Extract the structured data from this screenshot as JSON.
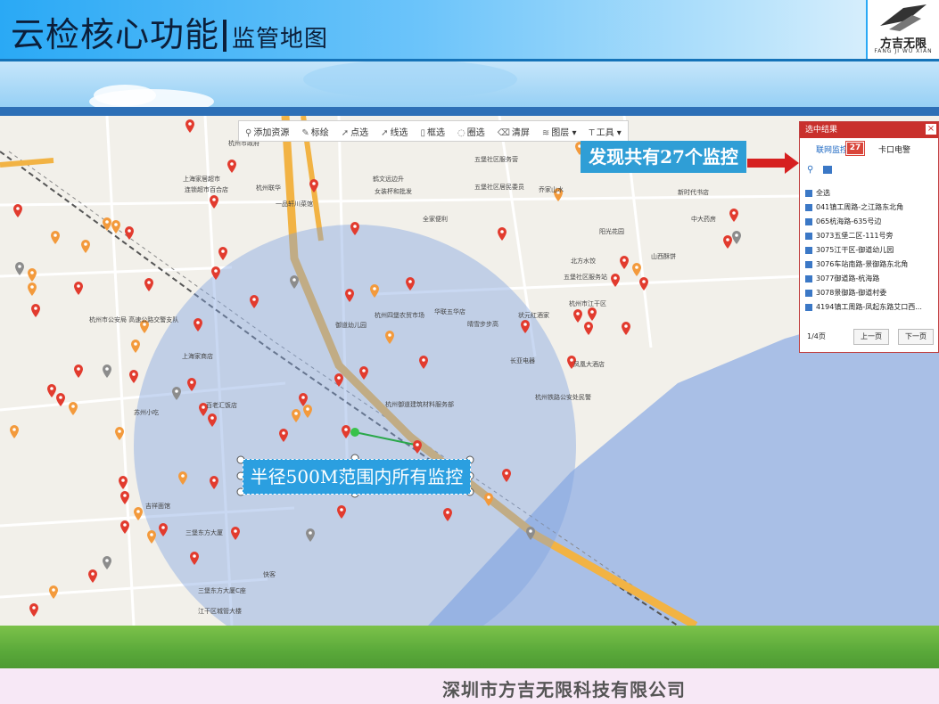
{
  "header": {
    "title": "云检核心功能",
    "subtitle": "监管地图",
    "logo_cn": "方吉无限",
    "logo_en": "FANG JI WU XIAN"
  },
  "toolbar": {
    "items": [
      "添加资源",
      "标绘",
      "点选",
      "线选",
      "框选",
      "圈选",
      "清屏",
      "图层",
      "工具"
    ]
  },
  "panel": {
    "title": "选中结果",
    "close": "×",
    "tab_networked": "联网监控",
    "count": "27",
    "tab_checkpoint": "卡口电警",
    "items": [
      "全选",
      "041镇工周路-之江路东北角",
      "065杭海路-635号边",
      "3073五堡二区-111号旁",
      "3075江干区-御道幼儿园",
      "3076车站南路-景御路东北角",
      "3077御道路-杭海路",
      "3078景御路-御道村委",
      "4194镇工周路-凤起东路艾口西..."
    ],
    "page_info": "1/4页",
    "prev": "上一页",
    "next": "下一页"
  },
  "callout": "发现共有27个监控",
  "radius_label": "半径500M范围内所有监控",
  "map_labels": [
    "杭州市政府",
    "上海家居超市",
    "连锁超市百合店",
    "杭州联华",
    "一品轩川菜馆",
    "鹤文远边升",
    "女装杯和批发",
    "五堡社区服务营",
    "五堡社区居民委员",
    "全家便利",
    "乔家山水",
    "杭州市公安局 高速公路交警支队",
    "上海家商店",
    "苏州小吃",
    "百老汇饭店",
    "杭州四堡农贸市场",
    "御道幼儿园",
    "华联五华店",
    "晴雪步步高",
    "状元红酒家",
    "长亚电器",
    "凤凰大酒店",
    "杭州御道建筑材料服务部",
    "杭州铁路公安处民警",
    "北方水饺",
    "五堡社区服务站",
    "杭州市江干区",
    "三堡东方大厦",
    "三堡东方大厦C座",
    "江干区城管大楼",
    "吉祥面馆",
    "快客",
    "山西酥饼",
    "新时代书店",
    "中大药房",
    "阳光花园"
  ],
  "footer": {
    "company": "深圳市方吉无限科技有限公司"
  }
}
